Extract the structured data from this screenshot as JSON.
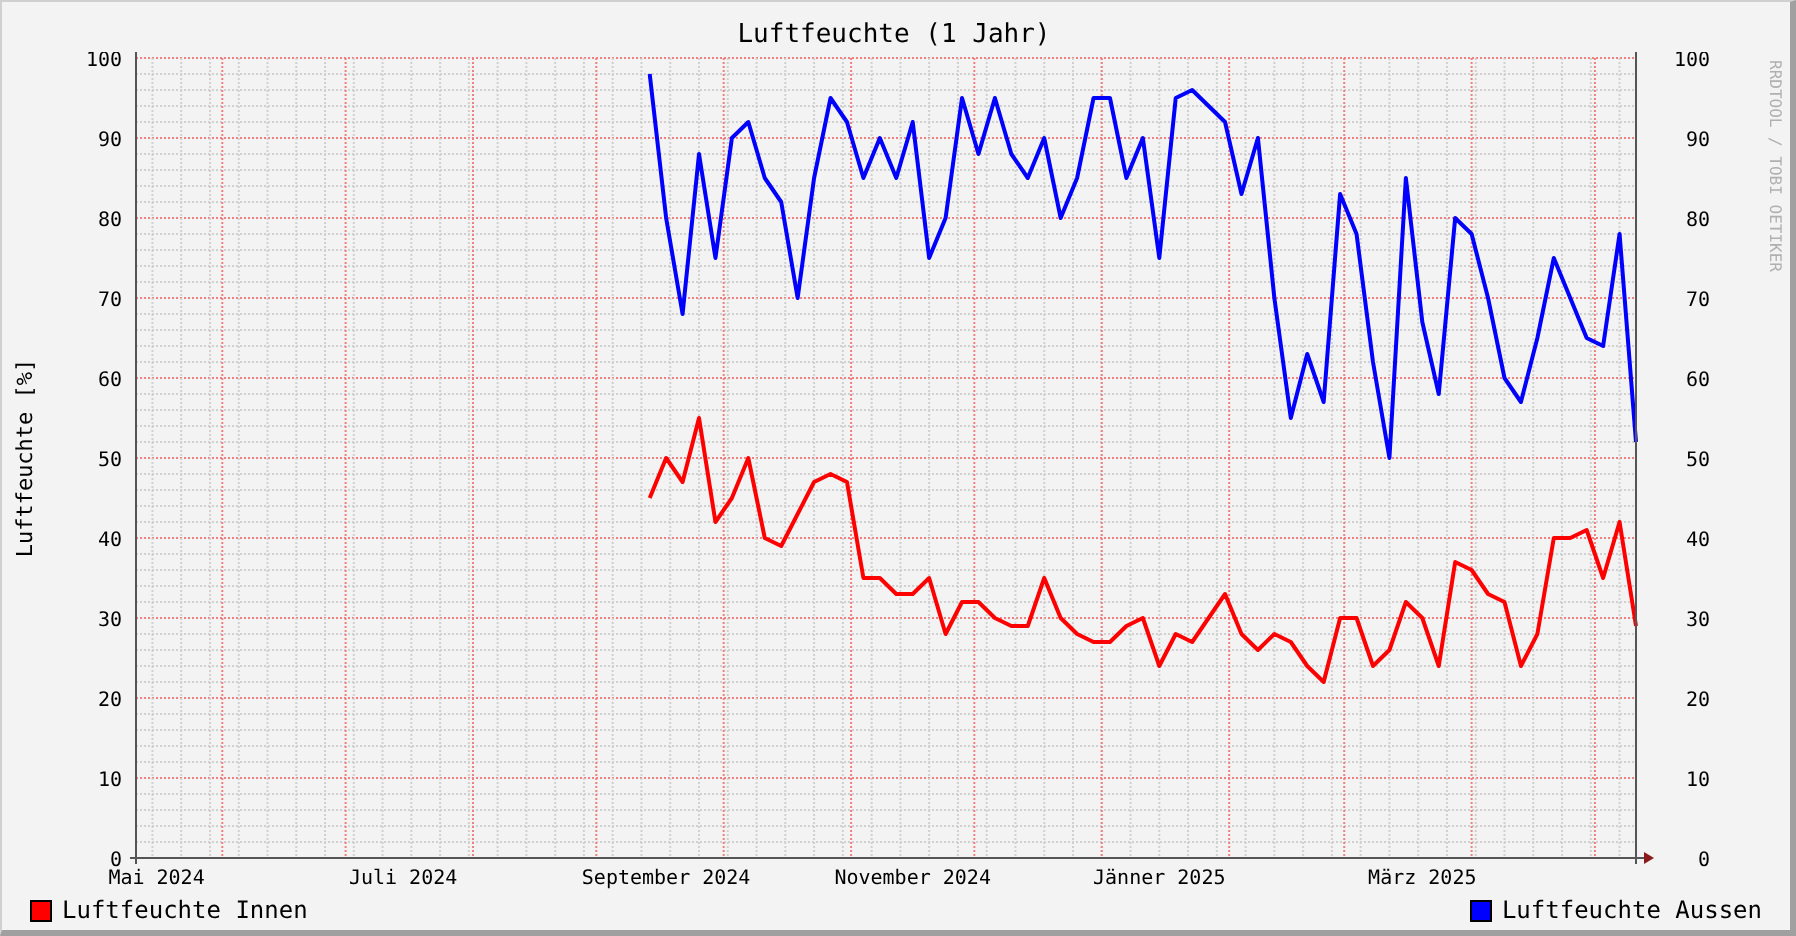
{
  "graph": {
    "chart_data": {
      "type": "line",
      "title": "Luftfeuchte (1 Jahr)",
      "ylabel": "Luftfeuchte [%]",
      "categories": [
        null,
        "Mai 2024",
        null,
        null,
        null,
        null,
        null,
        null,
        null,
        null,
        null,
        null,
        null,
        null,
        null,
        null,
        "Juli 2024",
        null,
        null,
        null,
        null,
        null,
        null,
        null,
        null,
        null,
        null,
        null,
        null,
        null,
        null,
        null,
        "September 2024",
        null,
        null,
        null,
        null,
        null,
        null,
        null,
        null,
        null,
        null,
        null,
        null,
        null,
        null,
        "November 2024",
        null,
        null,
        null,
        null,
        null,
        null,
        null,
        null,
        null,
        null,
        null,
        null,
        null,
        null,
        "Jänner 2025",
        null,
        null,
        null,
        null,
        null,
        null,
        null,
        null,
        null,
        null,
        null,
        null,
        null,
        null,
        null,
        "März 2025",
        null,
        null,
        null,
        null,
        null,
        null,
        null,
        null,
        null,
        null,
        null,
        null,
        null
      ],
      "ylim": [
        0,
        100
      ],
      "grid": true,
      "yticks": [
        0,
        10,
        20,
        30,
        40,
        50,
        60,
        70,
        80,
        90,
        100
      ],
      "series": [
        {
          "name": "Luftfeuchte Innen",
          "color": "#ff0000",
          "values": [
            null,
            null,
            null,
            null,
            null,
            null,
            null,
            null,
            null,
            null,
            null,
            null,
            null,
            null,
            null,
            null,
            null,
            null,
            null,
            null,
            null,
            null,
            null,
            null,
            null,
            null,
            null,
            null,
            null,
            null,
            null,
            45,
            50,
            47,
            55,
            42,
            45,
            50,
            40,
            39,
            43,
            47,
            48,
            47,
            35,
            35,
            33,
            33,
            35,
            28,
            32,
            32,
            30,
            29,
            29,
            35,
            30,
            28,
            27,
            27,
            29,
            30,
            24,
            28,
            27,
            30,
            33,
            28,
            26,
            28,
            27,
            24,
            22,
            30,
            30,
            24,
            26,
            32,
            30,
            24,
            37,
            36,
            33,
            32,
            24,
            28,
            40,
            40,
            41,
            35,
            42,
            29
          ]
        },
        {
          "name": "Luftfeuchte Aussen",
          "color": "#0000ff",
          "values": [
            null,
            null,
            null,
            null,
            null,
            null,
            null,
            null,
            null,
            null,
            null,
            null,
            null,
            null,
            null,
            null,
            null,
            null,
            null,
            null,
            null,
            null,
            null,
            null,
            null,
            null,
            null,
            null,
            null,
            null,
            null,
            98,
            80,
            68,
            88,
            75,
            90,
            92,
            85,
            82,
            70,
            85,
            95,
            92,
            85,
            90,
            85,
            92,
            75,
            80,
            95,
            88,
            95,
            88,
            85,
            90,
            80,
            85,
            95,
            95,
            85,
            90,
            75,
            95,
            96,
            94,
            92,
            83,
            90,
            70,
            55,
            63,
            57,
            83,
            78,
            62,
            50,
            85,
            67,
            58,
            80,
            78,
            70,
            60,
            57,
            65,
            75,
            70,
            65,
            64,
            78,
            52
          ]
        }
      ]
    },
    "right_axis": {
      "ticks": [
        "100",
        "90",
        "80",
        "70",
        "60",
        "50",
        "40",
        "30",
        "20",
        "10",
        "0"
      ]
    },
    "credit": "RRDTOOL / TOBI OETIKER"
  }
}
